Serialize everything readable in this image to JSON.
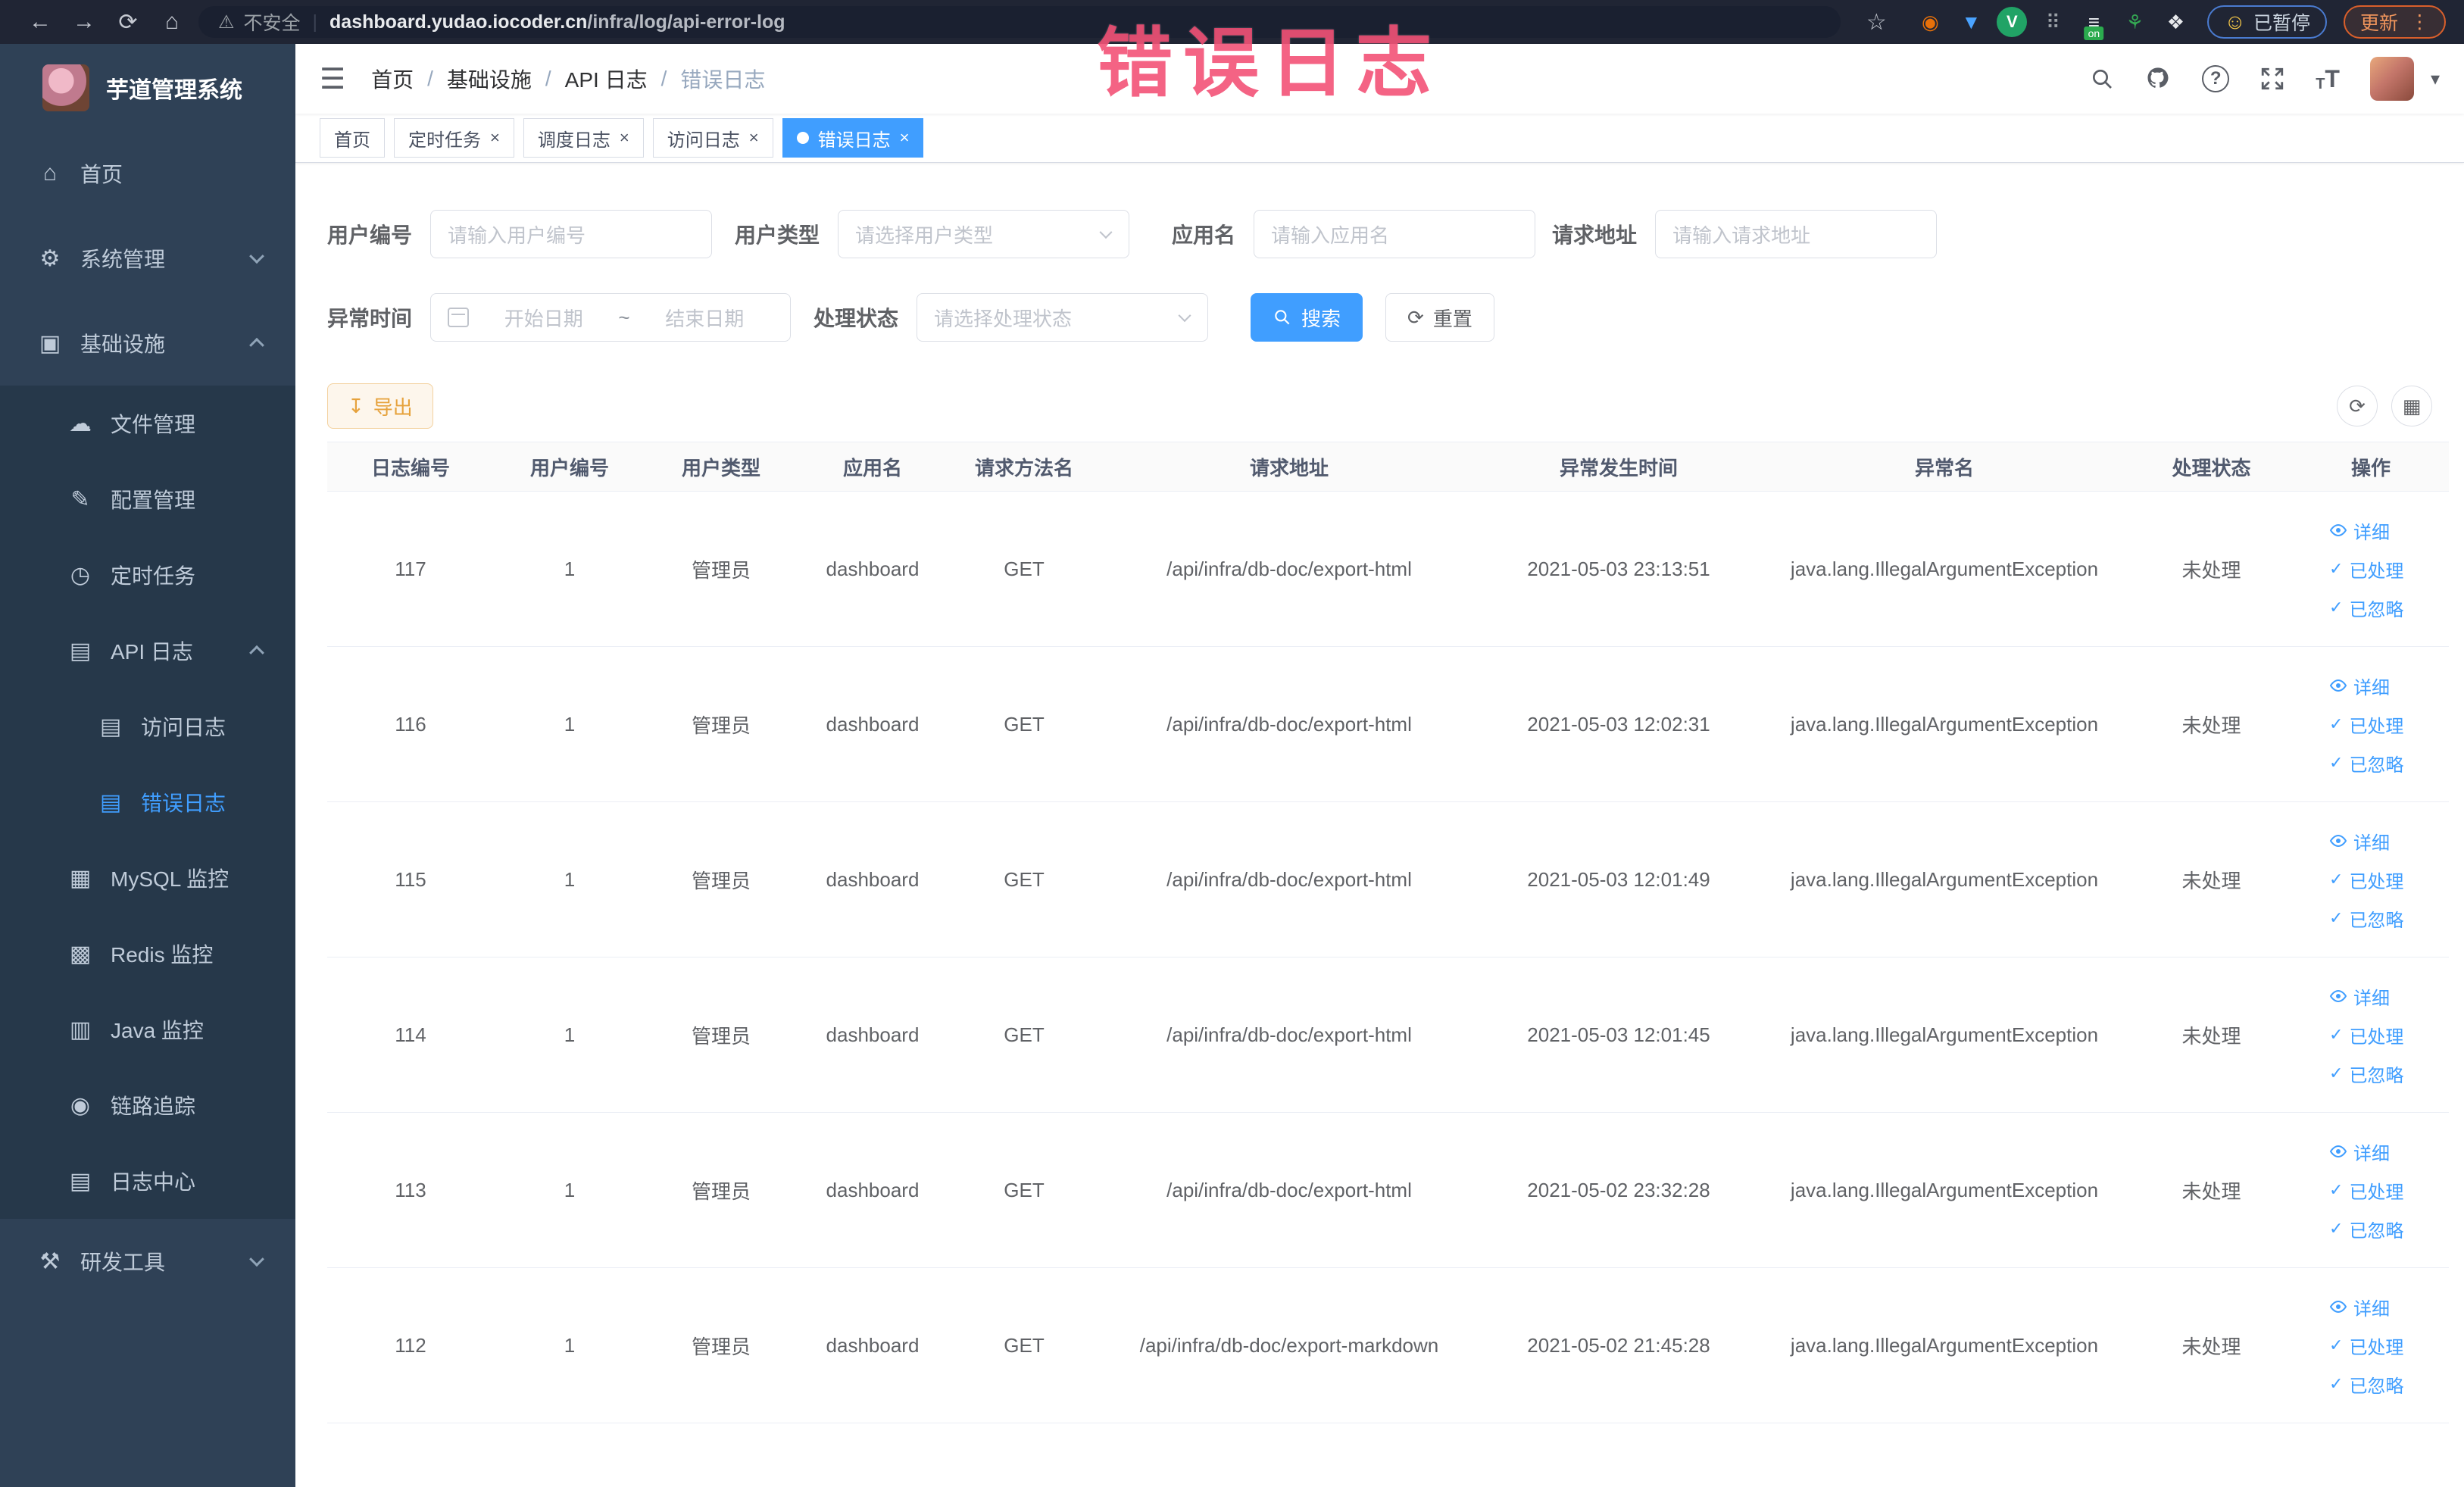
{
  "browser": {
    "nav": {
      "back": "←",
      "forward": "→",
      "reload": "⟳",
      "home": "⌂",
      "star": "☆",
      "menu": "⋮",
      "warning": "⚠"
    },
    "security_label": "不安全",
    "url_domain": "dashboard.yudao.iocoder.cn",
    "url_path": "/infra/log/api-error-log",
    "paused_label": "已暂停",
    "paused_face": "☺",
    "update_label": "更新",
    "ext_icons": [
      {
        "name": "extension-orange-ring-icon",
        "glyph": "◉",
        "color": "#e8710a",
        "bg": ""
      },
      {
        "name": "extension-shield-icon",
        "glyph": "▼",
        "color": "#4aa3ff",
        "bg": ""
      },
      {
        "name": "extension-v-circle-icon",
        "glyph": "V",
        "color": "#ffffff",
        "bg": "#21a366"
      },
      {
        "name": "extension-grid-icon",
        "glyph": "⠿",
        "color": "#9aa0a6",
        "bg": ""
      },
      {
        "name": "extension-onoff-icon",
        "glyph": "≡",
        "color": "#e8eaed",
        "bg": "",
        "badge": "on"
      },
      {
        "name": "extension-sprout-icon",
        "glyph": "⚘",
        "color": "#34a853",
        "bg": ""
      },
      {
        "name": "extension-puzzle-icon",
        "glyph": "❖",
        "color": "#e8eaed",
        "bg": ""
      }
    ]
  },
  "overlay_title": "错误日志",
  "sidebar": {
    "app_title": "芋道管理系统",
    "items": [
      {
        "key": "home",
        "label": "首页",
        "icon": "home-icon",
        "glyph": "⌂",
        "level": 0,
        "section": "root"
      },
      {
        "key": "system-management",
        "label": "系统管理",
        "icon": "gear-icon",
        "glyph": "⚙",
        "level": 0,
        "section": "root",
        "chevron": "down"
      },
      {
        "key": "infrastructure",
        "label": "基础设施",
        "icon": "monitor-icon",
        "glyph": "▣",
        "level": 0,
        "section": "root",
        "chevron": "up"
      },
      {
        "key": "file-management",
        "label": "文件管理",
        "icon": "cloud-upload-icon",
        "glyph": "☁",
        "level": 1,
        "section": "sub"
      },
      {
        "key": "config-management",
        "label": "配置管理",
        "icon": "edit-icon",
        "glyph": "✎",
        "level": 1,
        "section": "sub"
      },
      {
        "key": "scheduled-tasks",
        "label": "定时任务",
        "icon": "timer-icon",
        "glyph": "◷",
        "level": 1,
        "section": "sub"
      },
      {
        "key": "api-logs",
        "label": "API 日志",
        "icon": "log-document-icon",
        "glyph": "▤",
        "level": 1,
        "section": "sub",
        "chevron": "up"
      },
      {
        "key": "access-logs",
        "label": "访问日志",
        "icon": "document-icon",
        "glyph": "▤",
        "level": 2,
        "section": "sub"
      },
      {
        "key": "error-logs",
        "label": "错误日志",
        "icon": "document-icon",
        "glyph": "▤",
        "level": 2,
        "section": "sub",
        "active": true
      },
      {
        "key": "mysql-monitor",
        "label": "MySQL 监控",
        "icon": "chart-icon",
        "glyph": "▦",
        "level": 1,
        "section": "sub"
      },
      {
        "key": "redis-monitor",
        "label": "Redis 监控",
        "icon": "layers-icon",
        "glyph": "▩",
        "level": 1,
        "section": "sub"
      },
      {
        "key": "java-monitor",
        "label": "Java 监控",
        "icon": "java-monitor-icon",
        "glyph": "▥",
        "level": 1,
        "section": "sub"
      },
      {
        "key": "trace",
        "label": "链路追踪",
        "icon": "eye-icon",
        "glyph": "◉",
        "level": 1,
        "section": "sub"
      },
      {
        "key": "log-center",
        "label": "日志中心",
        "icon": "notebook-icon",
        "glyph": "▤",
        "level": 1,
        "section": "sub"
      },
      {
        "key": "dev-tools",
        "label": "研发工具",
        "icon": "briefcase-icon",
        "glyph": "⚒",
        "level": 0,
        "section": "root",
        "chevron": "down"
      }
    ]
  },
  "breadcrumb": [
    "首页",
    "基础设施",
    "API 日志",
    "错误日志"
  ],
  "tags": [
    {
      "label": "首页",
      "closable": false,
      "active": false
    },
    {
      "label": "定时任务",
      "closable": true,
      "active": false
    },
    {
      "label": "调度日志",
      "closable": true,
      "active": false
    },
    {
      "label": "访问日志",
      "closable": true,
      "active": false
    },
    {
      "label": "错误日志",
      "closable": true,
      "active": true
    }
  ],
  "filters": {
    "user_id": {
      "label": "用户编号",
      "placeholder": "请输入用户编号"
    },
    "user_type": {
      "label": "用户类型",
      "placeholder": "请选择用户类型"
    },
    "app_name": {
      "label": "应用名",
      "placeholder": "请输入应用名"
    },
    "request_url": {
      "label": "请求地址",
      "placeholder": "请输入请求地址"
    },
    "exception_time": {
      "label": "异常时间",
      "start_placeholder": "开始日期",
      "separator": "~",
      "end_placeholder": "结束日期"
    },
    "process_status": {
      "label": "处理状态",
      "placeholder": "请选择处理状态"
    },
    "search_label": "搜索",
    "reset_label": "重置",
    "reset_glyph": "⟳"
  },
  "toolbar": {
    "export_label": "导出",
    "export_glyph": "↧",
    "refresh_glyph": "⟳",
    "grid_glyph": "▦"
  },
  "table": {
    "columns": [
      "日志编号",
      "用户编号",
      "用户类型",
      "应用名",
      "请求方法名",
      "请求地址",
      "异常发生时间",
      "异常名",
      "处理状态",
      "操作"
    ],
    "actions": [
      "详细",
      "已处理",
      "已忽略"
    ],
    "rows": [
      {
        "id": "117",
        "user_id": "1",
        "user_type": "管理员",
        "app": "dashboard",
        "method": "GET",
        "url": "/api/infra/db-doc/export-html",
        "time": "2021-05-03 23:13:51",
        "exception": "java.lang.IllegalArgumentException",
        "status": "未处理"
      },
      {
        "id": "116",
        "user_id": "1",
        "user_type": "管理员",
        "app": "dashboard",
        "method": "GET",
        "url": "/api/infra/db-doc/export-html",
        "time": "2021-05-03 12:02:31",
        "exception": "java.lang.IllegalArgumentException",
        "status": "未处理"
      },
      {
        "id": "115",
        "user_id": "1",
        "user_type": "管理员",
        "app": "dashboard",
        "method": "GET",
        "url": "/api/infra/db-doc/export-html",
        "time": "2021-05-03 12:01:49",
        "exception": "java.lang.IllegalArgumentException",
        "status": "未处理"
      },
      {
        "id": "114",
        "user_id": "1",
        "user_type": "管理员",
        "app": "dashboard",
        "method": "GET",
        "url": "/api/infra/db-doc/export-html",
        "time": "2021-05-03 12:01:45",
        "exception": "java.lang.IllegalArgumentException",
        "status": "未处理"
      },
      {
        "id": "113",
        "user_id": "1",
        "user_type": "管理员",
        "app": "dashboard",
        "method": "GET",
        "url": "/api/infra/db-doc/export-html",
        "time": "2021-05-02 23:32:28",
        "exception": "java.lang.IllegalArgumentException",
        "status": "未处理"
      },
      {
        "id": "112",
        "user_id": "1",
        "user_type": "管理员",
        "app": "dashboard",
        "method": "GET",
        "url": "/api/infra/db-doc/export-markdown",
        "time": "2021-05-02 21:45:28",
        "exception": "java.lang.IllegalArgumentException",
        "status": "未处理"
      }
    ]
  },
  "colors": {
    "accent": "#409EFF",
    "warning": "#e6a23c",
    "annotation_pink": "#f2486e",
    "sidebar_bg": "#2f4156",
    "submenu_bg": "#26384a"
  }
}
